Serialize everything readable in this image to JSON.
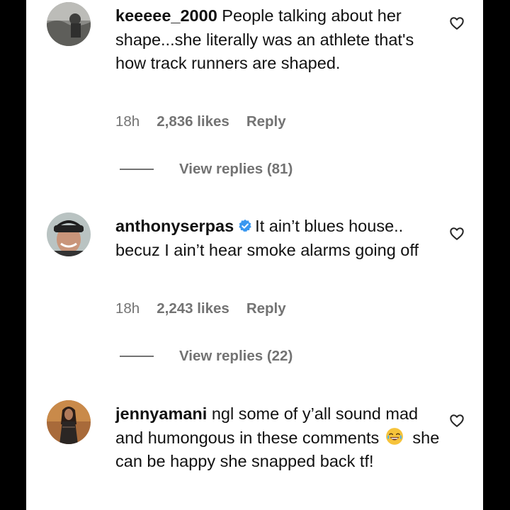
{
  "comments": [
    {
      "username": "keeeee_2000",
      "text": "People talking about her shape...she literally was an athlete that's how track runners are shaped.",
      "verified": false,
      "time": "18h",
      "likes": "2,836 likes",
      "reply": "Reply",
      "view_replies": "View replies (81)",
      "avatar": "avatar-photo-outdoor"
    },
    {
      "username": "anthonyserpas",
      "text": "It ain’t blues house.. becuz I ain’t hear smoke alarms going off",
      "verified": true,
      "time": "18h",
      "likes": "2,243 likes",
      "reply": "Reply",
      "view_replies": "View replies (22)",
      "avatar": "avatar-photo-man-cap"
    },
    {
      "username": "jennyamani",
      "text_before_emoji": "ngl some of y’all sound mad and humongous in these comments",
      "emoji": "😂",
      "text_after_emoji": "she can be happy she snapped back tf!",
      "verified": false,
      "avatar": "avatar-photo-woman"
    }
  ],
  "colors": {
    "text": "#111111",
    "secondary": "#737373",
    "verified": "#3897f0",
    "background": "#ffffff",
    "frame": "#000000"
  },
  "icons": [
    "heart-icon",
    "verified-badge-icon",
    "laughing-emoji-icon"
  ]
}
